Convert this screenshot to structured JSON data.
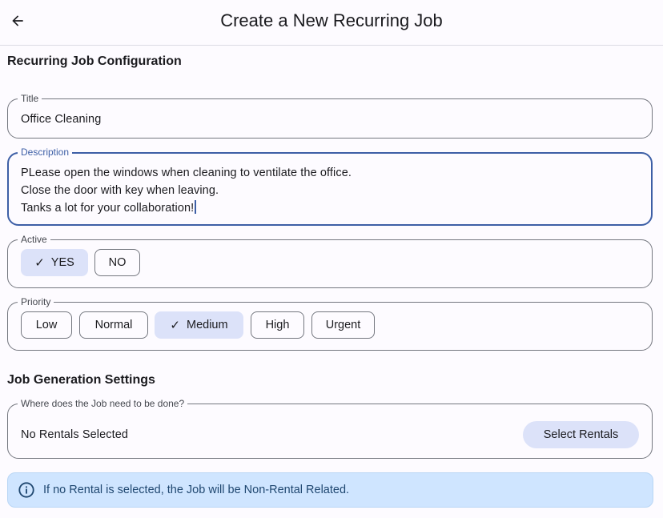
{
  "header": {
    "title": "Create a New Recurring Job",
    "back_icon": "arrow-left-icon"
  },
  "config_section": {
    "title": "Recurring Job Configuration"
  },
  "title_field": {
    "label": "Title",
    "value": "Office Cleaning"
  },
  "description_field": {
    "label": "Description",
    "lines": [
      "PLease open the windows when cleaning to ventilate the office.",
      "Close the door with key when leaving.",
      "Tanks a lot for your collaboration!"
    ]
  },
  "active": {
    "label": "Active",
    "options": [
      {
        "label": "YES",
        "selected": true
      },
      {
        "label": "NO",
        "selected": false
      }
    ]
  },
  "priority": {
    "label": "Priority",
    "options": [
      {
        "label": "Low",
        "selected": false
      },
      {
        "label": "Normal",
        "selected": false
      },
      {
        "label": "Medium",
        "selected": true
      },
      {
        "label": "High",
        "selected": false
      },
      {
        "label": "Urgent",
        "selected": false
      }
    ]
  },
  "generation_section": {
    "title": "Job Generation Settings"
  },
  "location": {
    "label": "Where does the Job need to be done?",
    "value": "No Rentals Selected",
    "button_label": "Select Rentals"
  },
  "info_banner": {
    "icon": "info-circle-icon",
    "text": "If no Rental is selected, the Job will be Non-Rental Related."
  },
  "colors": {
    "accent": "#3d5fa6",
    "chip_selected": "#dce2f9",
    "info_bg": "#cfe5ff",
    "info_text": "#1f4770"
  }
}
